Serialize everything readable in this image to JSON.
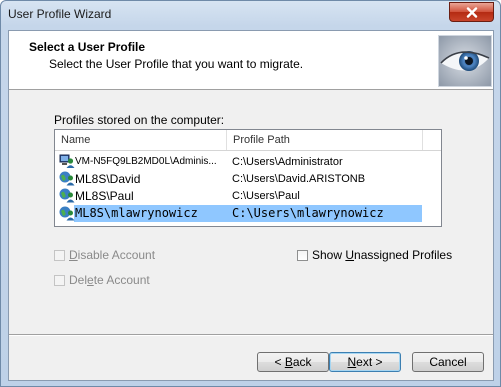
{
  "window": {
    "title": "User Profile Wizard"
  },
  "header": {
    "title": "Select a User Profile",
    "subtitle": "Select the User Profile that you want to migrate."
  },
  "profiles": {
    "group_label": "Profiles stored on the computer:",
    "columns": [
      "Name",
      "Profile Path"
    ],
    "rows": [
      {
        "name": "VM-N5FQ9LB2MD0L\\Adminis...",
        "path": "C:\\Users\\Administrator",
        "icon": "computer-user-icon",
        "selected": false
      },
      {
        "name": "ML8S\\David",
        "path": "C:\\Users\\David.ARISTONB",
        "icon": "domain-user-icon",
        "selected": false
      },
      {
        "name": "ML8S\\Paul",
        "path": "C:\\Users\\Paul",
        "icon": "domain-user-icon",
        "selected": false
      },
      {
        "name": "ML8S\\mlawrynowicz",
        "path": "C:\\Users\\mlawrynowicz",
        "icon": "domain-user-icon",
        "selected": true
      }
    ]
  },
  "options": {
    "disable_account": {
      "label_u": "D",
      "label_rest": "isable Account",
      "checked": false,
      "enabled": false
    },
    "delete_account": {
      "label_pre": "Del",
      "label_u": "e",
      "label_rest": "te Account",
      "checked": false,
      "enabled": false
    },
    "show_unassigned": {
      "label_pre": "Show ",
      "label_u": "U",
      "label_rest": "nassigned Profiles",
      "checked": false,
      "enabled": true
    }
  },
  "buttons": {
    "back_prefix": "< ",
    "back_u": "B",
    "back_rest": "ack",
    "next_u": "N",
    "next_rest": "ext >",
    "cancel": "Cancel"
  },
  "colors": {
    "selection": "#3399ff",
    "close_button": "#c9452b",
    "title_bar": "#c5d6ea"
  }
}
